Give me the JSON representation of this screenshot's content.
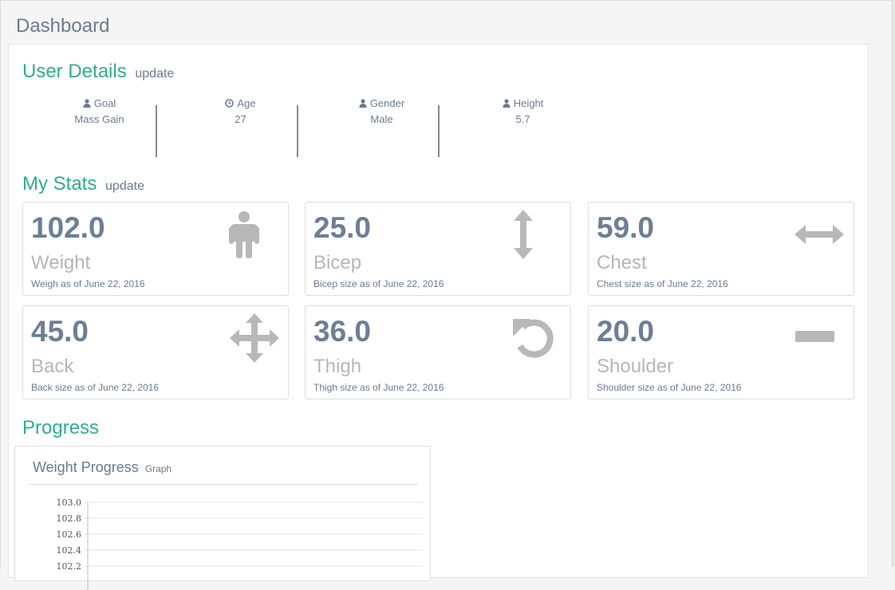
{
  "page": {
    "title": "Dashboard"
  },
  "user_details": {
    "title": "User Details",
    "update_label": "update",
    "fields": [
      {
        "icon": "user-icon",
        "label": "Goal",
        "value": "Mass Gain"
      },
      {
        "icon": "clock-icon",
        "label": "Age",
        "value": "27"
      },
      {
        "icon": "user-icon",
        "label": "Gender",
        "value": "Male"
      },
      {
        "icon": "user-icon",
        "label": "Height",
        "value": "5.7"
      }
    ]
  },
  "stats": {
    "title": "My Stats",
    "update_label": "update",
    "cards": [
      {
        "value": "102.0",
        "name": "Weight",
        "subtitle": "Weigh as of June 22, 2016",
        "icon": "person-icon"
      },
      {
        "value": "25.0",
        "name": "Bicep",
        "subtitle": "Bicep size as of June 22, 2016",
        "icon": "vertical-arrows-icon"
      },
      {
        "value": "59.0",
        "name": "Chest",
        "subtitle": "Chest size as of June 22, 2016",
        "icon": "horizontal-arrows-icon"
      },
      {
        "value": "45.0",
        "name": "Back",
        "subtitle": "Back size as of June 22, 2016",
        "icon": "move-arrows-icon"
      },
      {
        "value": "36.0",
        "name": "Thigh",
        "subtitle": "Thigh size as of June 22, 2016",
        "icon": "undo-icon"
      },
      {
        "value": "20.0",
        "name": "Shoulder",
        "subtitle": "Shoulder size as of June 22, 2016",
        "icon": "minus-icon"
      }
    ],
    "icon_color": "#b8b8b8",
    "value_color": "#6b7f96"
  },
  "progress": {
    "title": "Progress",
    "graph_title": "Weight Progress",
    "graph_tag": "Graph"
  },
  "chart_data": {
    "type": "line",
    "ylim": [
      102.2,
      103.0
    ],
    "y_ticks": [
      "103.0",
      "102.8",
      "102.6",
      "102.4",
      "102.2"
    ],
    "grid": true,
    "series": []
  },
  "colors": {
    "accent": "#2fae8e",
    "text": "#6b7b8f",
    "muted": "#b6b6b6"
  }
}
